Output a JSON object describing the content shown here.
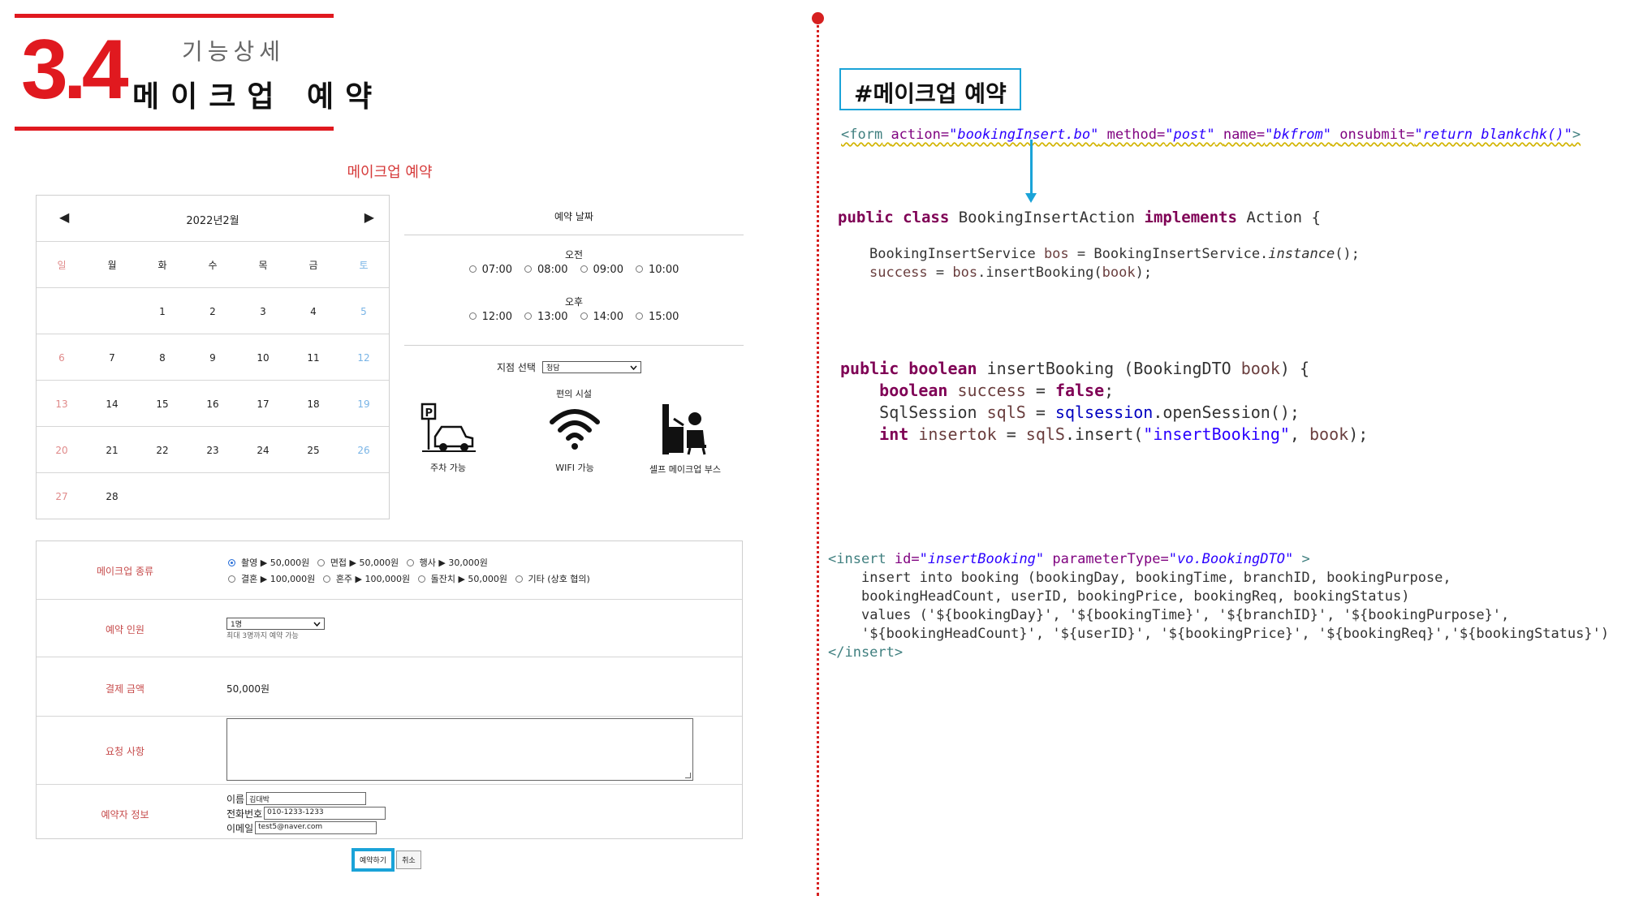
{
  "header": {
    "number": "3.4",
    "subtitle": "기능상세",
    "title": "메이크업 예약"
  },
  "mockup": {
    "title": "메이크업 예약",
    "calendar": {
      "prev_icon": "◀",
      "next_icon": "▶",
      "month": "2022년2월",
      "weekdays": [
        "일",
        "월",
        "화",
        "수",
        "목",
        "금",
        "토"
      ],
      "weeks": [
        [
          "",
          "",
          "1",
          "2",
          "3",
          "4",
          "5"
        ],
        [
          "6",
          "7",
          "8",
          "9",
          "10",
          "11",
          "12"
        ],
        [
          "13",
          "14",
          "15",
          "16",
          "17",
          "18",
          "19"
        ],
        [
          "20",
          "21",
          "22",
          "23",
          "24",
          "25",
          "26"
        ],
        [
          "27",
          "28",
          "",
          "",
          "",
          "",
          ""
        ]
      ]
    },
    "schedule": {
      "header": "예약 날짜",
      "am_label": "오전",
      "am_times": [
        "07:00",
        "08:00",
        "09:00",
        "10:00"
      ],
      "pm_label": "오후",
      "pm_times": [
        "12:00",
        "13:00",
        "14:00",
        "15:00"
      ],
      "branch_label": "지점 선택",
      "branch_value": "청담",
      "facilities_title": "편의 시설",
      "facilities": [
        {
          "icon": "parking-car-icon",
          "label": "주차 가능"
        },
        {
          "icon": "wifi-icon",
          "label": "WIFI 가능"
        },
        {
          "icon": "makeup-booth-icon",
          "label": "셀프 메이크업 부스"
        }
      ]
    },
    "form": {
      "type_label": "메이크업 종류",
      "type_options_row1": [
        "촬영 ▶ 50,000원",
        "면접 ▶ 50,000원",
        "행사 ▶ 30,000원"
      ],
      "type_options_row2": [
        "결혼 ▶ 100,000원",
        "혼주 ▶ 100,000원",
        "돌잔치 ▶ 50,000원",
        "기타 (상호 협의)"
      ],
      "count_label": "예약 인원",
      "count_value": "1명",
      "count_hint": "최대 3명까지 예약 가능",
      "price_label": "결제 금액",
      "price_value": "50,000원",
      "request_label": "요청 사항",
      "info_label": "예약자 정보",
      "name_label": "이름",
      "name_value": "김대박",
      "phone_label": "전화번호",
      "phone_value": "010-1233-1233",
      "email_label": "이메일",
      "email_value": "test5@naver.com"
    },
    "buttons": {
      "reserve": "예약하기",
      "cancel": "취소"
    }
  },
  "code": {
    "section_title": "#메이크업 예약",
    "form_tag": {
      "open": "<form",
      "action_attr": "action=",
      "action_val": "\"bookingInsert.bo\"",
      "method_attr": "method=",
      "method_val": "\"post\"",
      "name_attr": "name=",
      "name_val": "\"bkfrom\"",
      "onsubmit_attr": "onsubmit=",
      "onsubmit_val": "\"return blankchk()\"",
      "close": ">"
    },
    "action_class": {
      "kw1": "public class",
      "name": "BookingInsertAction",
      "kw2": "implements",
      "iface": "Action {",
      "line1_a": "BookingInsertService ",
      "line1_var": "bos",
      "line1_b": " = BookingInsertService.",
      "line1_method": "instance",
      "line1_c": "();",
      "line2_var": "success",
      "line2_b": " = ",
      "line2_var2": "bos",
      "line2_c": ".insertBooking(",
      "line2_var3": "book",
      "line2_d": ");"
    },
    "dao": {
      "l1_kw": "public boolean",
      "l1_name": "insertBooking",
      "l1_a": "(BookingDTO ",
      "l1_var": "book",
      "l1_b": ") {",
      "l2_kw": "boolean",
      "l2_var": "success",
      "l2_a": " = ",
      "l2_kw2": "false",
      "l2_b": ";",
      "l3_a": "SqlSession ",
      "l3_var": "sqlS",
      "l3_b": " = ",
      "l3_fld": "sqlsession",
      "l3_c": ".openSession();",
      "l4_kw": "int",
      "l4_var": "insertok",
      "l4_a": " = ",
      "l4_var2": "sqlS",
      "l4_b": ".insert(",
      "l4_str": "\"insertBooking\"",
      "l4_c": ", ",
      "l4_var3": "book",
      "l4_d": ");"
    },
    "mapper": {
      "open": "<insert",
      "id_attr": "id=",
      "id_val": "\"insertBooking\"",
      "pt_attr": "parameterType=",
      "pt_val": "\"vo.BookingDTO\"",
      "open_end": " >",
      "line1": "insert into booking (bookingDay, bookingTime, branchID, bookingPurpose,",
      "line2": "bookingHeadCount, userID, bookingPrice, bookingReq, bookingStatus)",
      "line3": "values ('${bookingDay}', '${bookingTime}', '${branchID}', '${bookingPurpose}',",
      "line4": "'${bookingHeadCount}', '${userID}', '${bookingPrice}', '${bookingReq}','${bookingStatus}')",
      "close": "</insert>"
    }
  },
  "colors": {
    "accent_red": "#e0191f",
    "accent_blue": "#1aa3d8"
  }
}
